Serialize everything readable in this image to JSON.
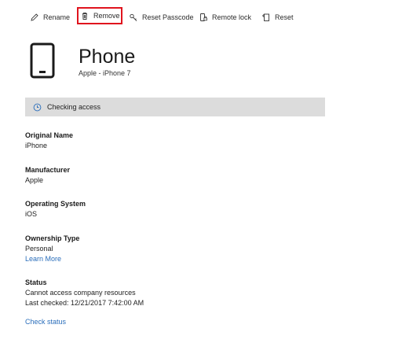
{
  "toolbar": {
    "rename_label": "Rename",
    "remove_label": "Remove",
    "reset_passcode_label": "Reset Passcode",
    "remote_lock_label": "Remote lock",
    "reset_label": "Reset"
  },
  "header": {
    "title": "Phone",
    "subtitle": "Apple - iPhone 7"
  },
  "banner": {
    "text": "Checking access"
  },
  "fields": {
    "original_name": {
      "label": "Original Name",
      "value": "iPhone"
    },
    "manufacturer": {
      "label": "Manufacturer",
      "value": "Apple"
    },
    "operating_system": {
      "label": "Operating System",
      "value": "iOS"
    },
    "ownership_type": {
      "label": "Ownership Type",
      "value": "Personal",
      "link": "Learn More"
    },
    "status": {
      "label": "Status",
      "value": "Cannot access company resources",
      "last_checked": "Last checked: 12/21/2017 7:42:00 AM"
    }
  },
  "actions": {
    "check_status": "Check status"
  },
  "colors": {
    "highlight": "#e0141e",
    "link": "#2a6ebb",
    "banner_bg": "#dcdcdc"
  }
}
